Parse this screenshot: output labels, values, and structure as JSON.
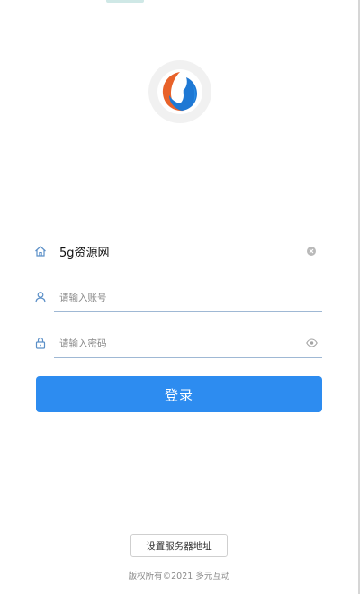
{
  "colors": {
    "accent": "#2d8cf0",
    "underline": "#9fb8d4",
    "muted_text": "#8a8a8a",
    "icon": "#5b8fc7"
  },
  "logo": {
    "icon": "app-logo-icon"
  },
  "form": {
    "server": {
      "icon": "home-icon",
      "value": "5g资源网",
      "clear_icon": "clear-icon"
    },
    "account": {
      "icon": "user-icon",
      "placeholder": "请输入账号",
      "value": ""
    },
    "password": {
      "icon": "lock-icon",
      "placeholder": "请输入密码",
      "value": "",
      "toggle_icon": "eye-icon"
    },
    "login_label": "登录"
  },
  "footer": {
    "server_button_label": "设置服务器地址",
    "copyright": "版权所有©2021 多元互动"
  }
}
